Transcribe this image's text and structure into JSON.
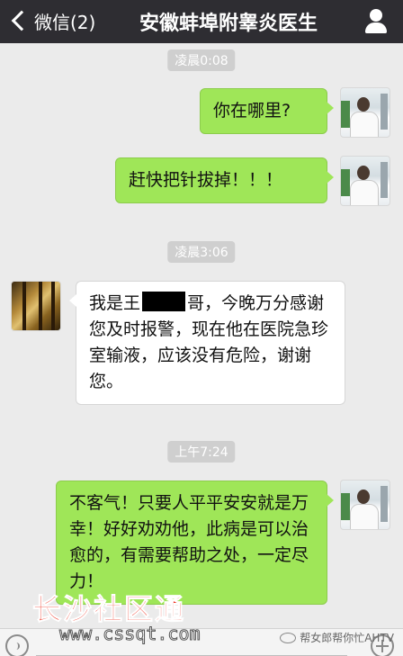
{
  "header": {
    "back_label": "微信(2)",
    "title": "安徽蚌埠附睾炎医生"
  },
  "timestamps": [
    "凌晨0:08",
    "凌晨3:06",
    "上午7:24"
  ],
  "messages": [
    {
      "side": "right",
      "text": "你在哪里?"
    },
    {
      "side": "right",
      "text": "赶快把针拔掉！！！"
    },
    {
      "side": "left",
      "text_before": "我是王",
      "text_after": "哥，今晚万分感谢您及时报警，现在他在医院急珍室输液，应该没有危险，谢谢您。"
    },
    {
      "side": "right",
      "text": "不客气！只要人平平安安就是万幸！好好劝劝他，此病是可以治愈的，有需要帮助之处，一定尽力！"
    }
  ],
  "watermarks": {
    "site_name": "长沙社区通",
    "site_url": "www.cssqt.com",
    "wechat_source": "帮女郎帮你忙AHTV"
  },
  "icons": {
    "back": "chevron-left-icon",
    "profile": "person-icon",
    "voice": "voice-icon",
    "plus": "plus-icon"
  },
  "colors": {
    "topbar": "#2e2d32",
    "background": "#ebebeb",
    "sent_bubble": "#9fe658",
    "received_bubble": "#ffffff"
  }
}
